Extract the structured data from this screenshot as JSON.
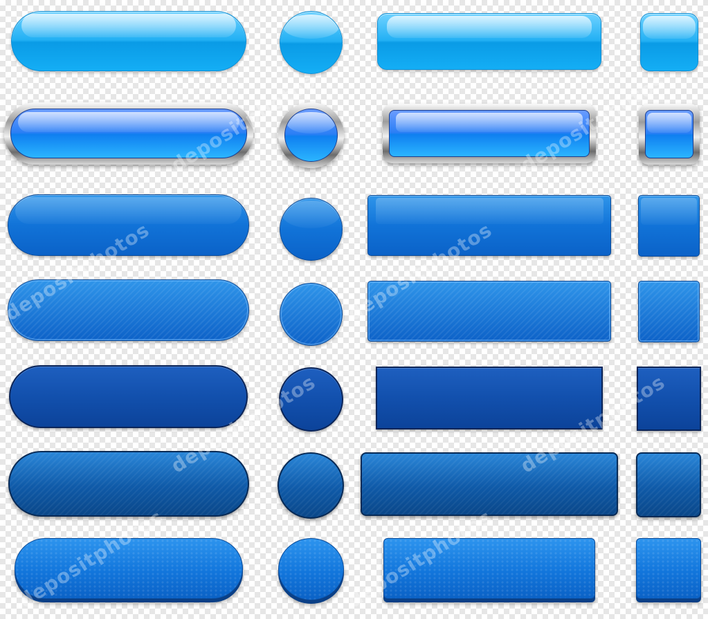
{
  "watermark": {
    "text": "depositphotos"
  },
  "colors": {
    "row1_light_cyan": "#22b0f4",
    "row2_chrome_blue": "#2b7ff5",
    "row3_medium_blue": "#1173d8",
    "row4_striped_blue": "#1a7ddf",
    "row5_dark_navy": "#1250ad",
    "row6_dark_striped": "#1262b2",
    "row7_hex_blue": "#1777db",
    "chrome_frame": "#9c9c9c"
  },
  "rows": [
    {
      "style": "light glossy cyan",
      "shapes": [
        "pill",
        "circle",
        "rounded-rect",
        "square"
      ]
    },
    {
      "style": "chrome framed",
      "shapes": [
        "pill",
        "circle",
        "rounded-rect",
        "square"
      ]
    },
    {
      "style": "medium blue",
      "shapes": [
        "pill",
        "circle",
        "rounded-rect",
        "square"
      ]
    },
    {
      "style": "striped blue",
      "shapes": [
        "pill",
        "circle",
        "rounded-rect",
        "square"
      ]
    },
    {
      "style": "dark navy",
      "shapes": [
        "pill",
        "circle",
        "rect",
        "square"
      ]
    },
    {
      "style": "dark striped",
      "shapes": [
        "pill",
        "circle",
        "rounded-rect",
        "square"
      ]
    },
    {
      "style": "hex texture",
      "shapes": [
        "pill",
        "circle",
        "rounded-rect",
        "square"
      ]
    }
  ]
}
